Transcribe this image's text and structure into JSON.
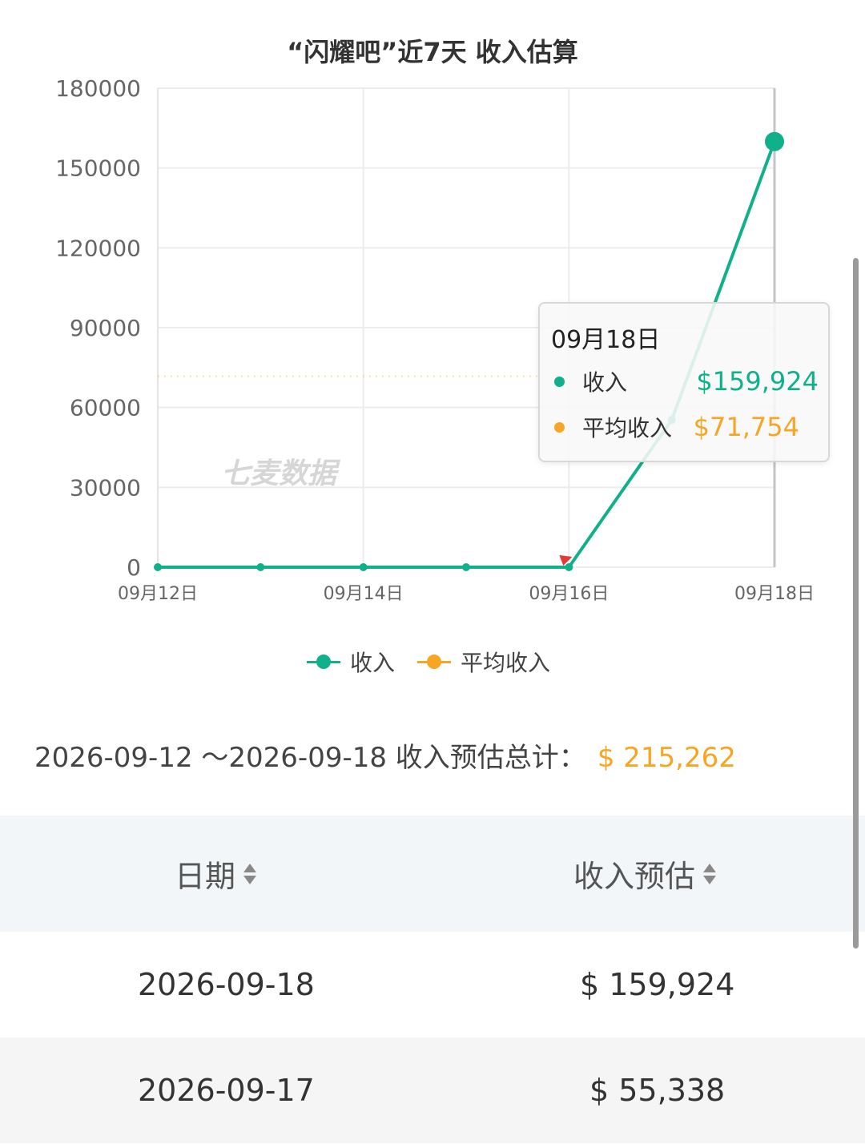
{
  "chart_data": {
    "type": "line",
    "title": "“闪耀吧”近7天 收入估算",
    "x": [
      "09月12日",
      "09月13日",
      "09月14日",
      "09月15日",
      "09月16日",
      "09月17日",
      "09月18日"
    ],
    "x_tick_labels": [
      "09月12日",
      "09月14日",
      "09月16日",
      "09月18日"
    ],
    "y_tick_labels": [
      "0",
      "30000",
      "60000",
      "90000",
      "120000",
      "150000",
      "180000"
    ],
    "ylim": [
      0,
      180000
    ],
    "grid": true,
    "legend": "bottom-center",
    "series": [
      {
        "name": "收入",
        "color": "#10b08a",
        "values": [
          0,
          0,
          0,
          0,
          0,
          55338,
          159924
        ]
      },
      {
        "name": "平均收入",
        "color": "#f6a623",
        "values": [
          71754,
          71754,
          71754,
          71754,
          71754,
          71754,
          71754
        ]
      }
    ],
    "watermark": "七麦数据",
    "tooltip": {
      "date": "09月18日",
      "rows": [
        {
          "label": "收入",
          "value": "$159,924"
        },
        {
          "label": "平均收入",
          "value": "$71,754"
        }
      ]
    }
  },
  "summary": {
    "range_text": "2026-09-12 ～2026-09-18 收入预估总计：",
    "total": "$ 215,262"
  },
  "table": {
    "headers": [
      "日期",
      "收入预估"
    ],
    "rows": [
      [
        "2026-09-18",
        "$ 159,924"
      ],
      [
        "2026-09-17",
        "$ 55,338"
      ]
    ]
  }
}
